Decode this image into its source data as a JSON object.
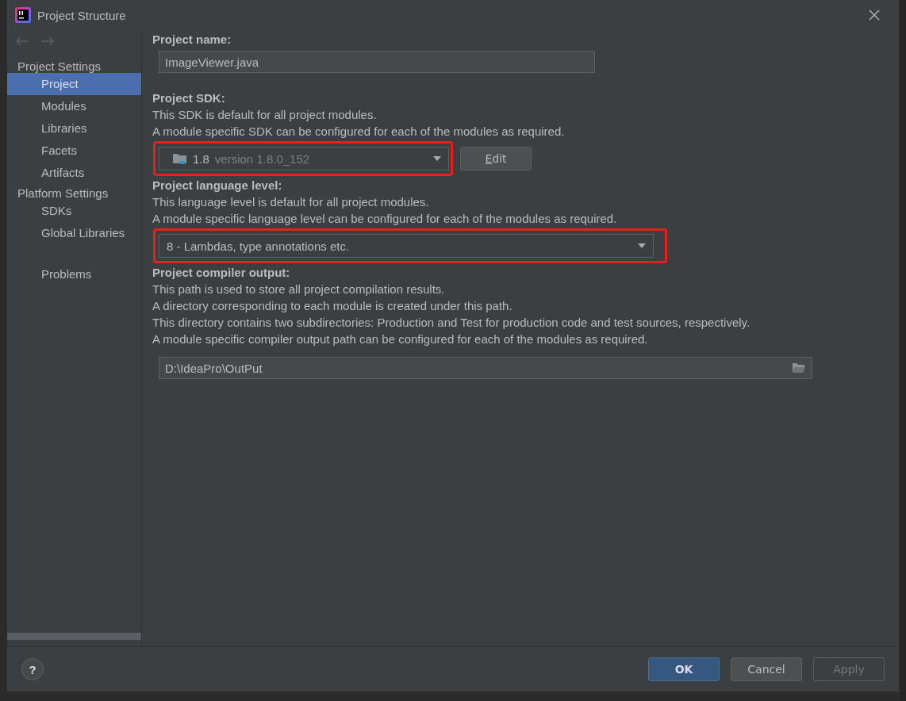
{
  "window": {
    "title": "Project Structure"
  },
  "sidebar": {
    "groups": [
      {
        "heading": "Project Settings",
        "items": [
          {
            "label": "Project",
            "selected": true
          },
          {
            "label": "Modules",
            "selected": false
          },
          {
            "label": "Libraries",
            "selected": false
          },
          {
            "label": "Facets",
            "selected": false
          },
          {
            "label": "Artifacts",
            "selected": false
          }
        ]
      },
      {
        "heading": "Platform Settings",
        "items": [
          {
            "label": "SDKs",
            "selected": false
          },
          {
            "label": "Global Libraries",
            "selected": false
          }
        ]
      },
      {
        "items": [
          {
            "label": "Problems",
            "selected": false
          }
        ]
      }
    ]
  },
  "project_name": {
    "label": "Project name:",
    "value": "ImageViewer.java"
  },
  "project_sdk": {
    "label": "Project SDK:",
    "description": [
      "This SDK is default for all project modules.",
      "A module specific SDK can be configured for each of the modules as required."
    ],
    "sdk_name": "1.8",
    "sdk_version": "version 1.8.0_152",
    "edit_button": "Edit",
    "highlighted": true
  },
  "language_level": {
    "label": "Project language level:",
    "description": [
      "This language level is default for all project modules.",
      "A module specific language level can be configured for each of the modules as required."
    ],
    "value": "8 - Lambdas, type annotations etc.",
    "highlighted": true
  },
  "compiler_output": {
    "label": "Project compiler output:",
    "description": [
      "This path is used to store all project compilation results.",
      "A directory corresponding to each module is created under this path.",
      "This directory contains two subdirectories: Production and Test for production code and test sources, respectively.",
      "A module specific compiler output path can be configured for each of the modules as required."
    ],
    "value": "D:\\IdeaPro\\OutPut"
  },
  "help_button": "?",
  "buttons": [
    {
      "label": "OK",
      "kind": "primary",
      "disabled": false
    },
    {
      "label": "Cancel",
      "kind": "normal",
      "disabled": false
    },
    {
      "label": "Apply",
      "kind": "normal",
      "disabled": true
    }
  ]
}
